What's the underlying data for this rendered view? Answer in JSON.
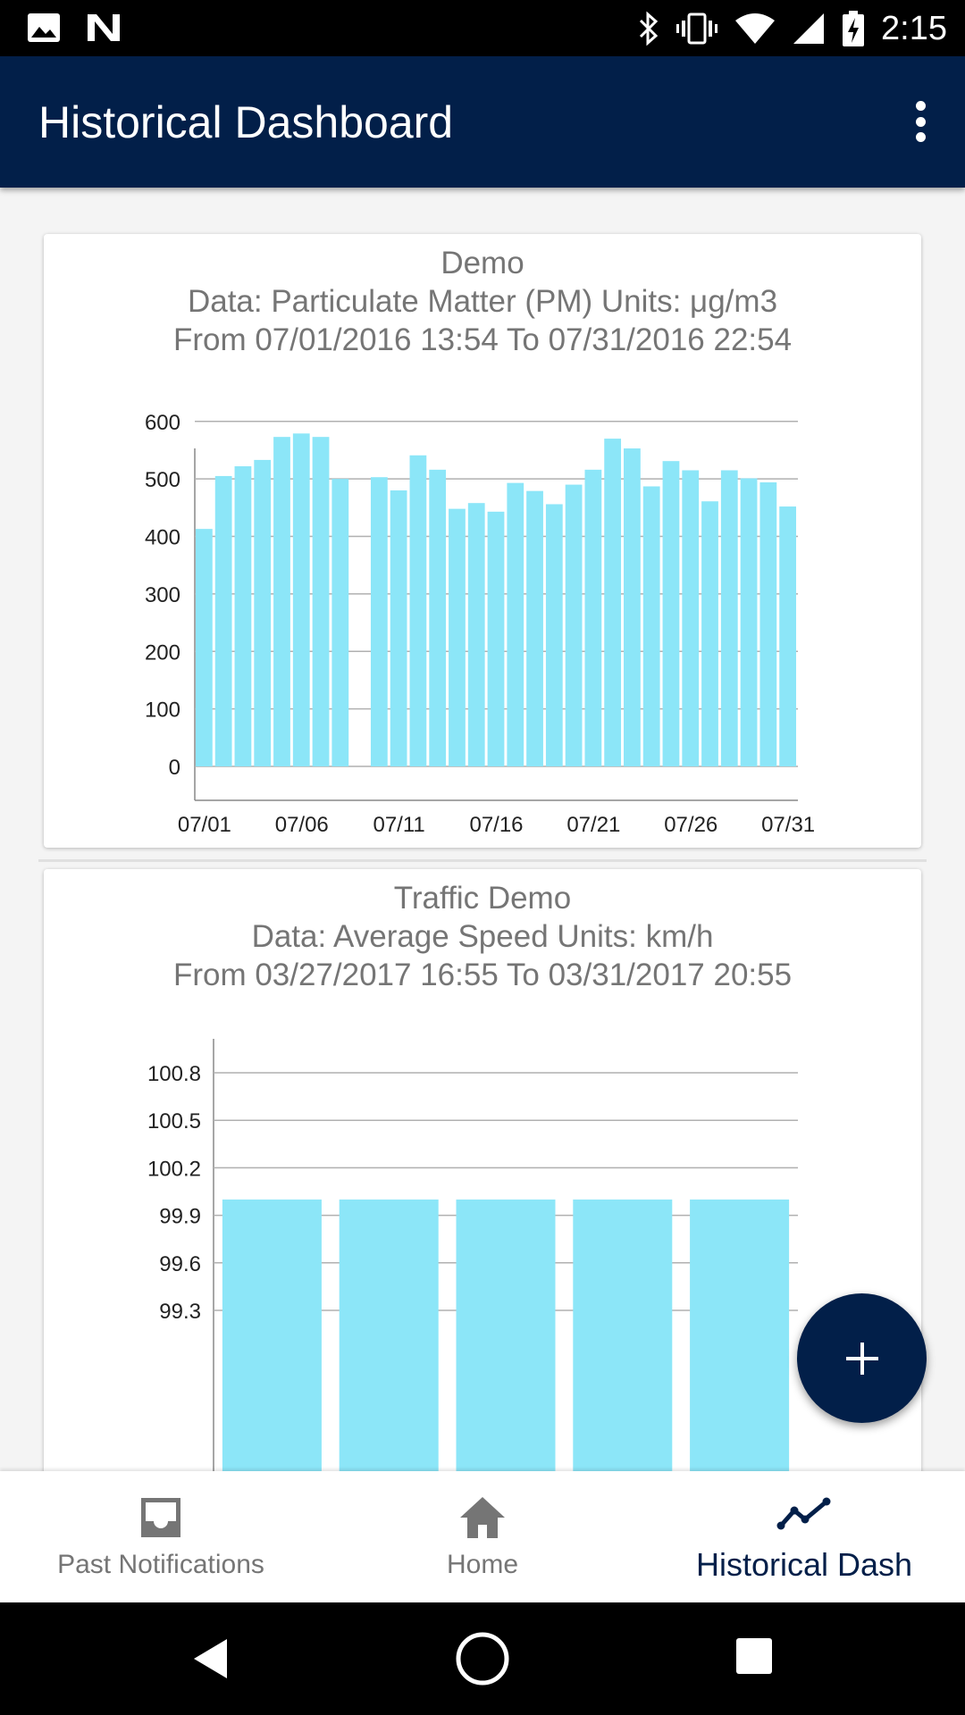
{
  "status_bar": {
    "time": "2:15",
    "left_icons": [
      "image-icon",
      "n-logo-icon"
    ],
    "right_icons": [
      "bluetooth-icon",
      "vibrate-icon",
      "wifi-icon",
      "signal-icon",
      "battery-charging-icon"
    ]
  },
  "app_bar": {
    "title": "Historical Dashboard",
    "menu_icon": "more-vert-icon"
  },
  "cards": [
    {
      "title": "Demo",
      "data_line": "Data: Particulate Matter (PM) Units: μg/m3",
      "range_line": "From 07/01/2016 13:54 To 07/31/2016 22:54"
    },
    {
      "title": "Traffic Demo",
      "data_line": "Data: Average Speed Units: km/h",
      "range_line": "From 03/27/2017 16:55 To 03/31/2017 20:55"
    }
  ],
  "chart_data": [
    {
      "type": "bar",
      "color": "#8ce6f8",
      "y_ticks": [
        0,
        100,
        200,
        300,
        400,
        500,
        600
      ],
      "ylim": [
        0,
        640
      ],
      "x_tick_labels": [
        "07/01",
        "07/06",
        "07/11",
        "07/16",
        "07/21",
        "07/26",
        "07/31"
      ],
      "categories": [
        "07/01",
        "07/02",
        "07/03",
        "07/04",
        "07/05",
        "07/06",
        "07/07",
        "07/08",
        "07/09",
        "07/10",
        "07/11",
        "07/12",
        "07/13",
        "07/14",
        "07/15",
        "07/16",
        "07/17",
        "07/18",
        "07/19",
        "07/20",
        "07/21",
        "07/22",
        "07/23",
        "07/24",
        "07/25",
        "07/26",
        "07/27",
        "07/28",
        "07/29",
        "07/30",
        "07/31"
      ],
      "values": [
        413,
        505,
        522,
        533,
        573,
        579,
        573,
        500,
        null,
        503,
        480,
        541,
        516,
        448,
        458,
        443,
        493,
        479,
        456,
        490,
        516,
        570,
        553,
        487,
        531,
        515,
        461,
        515,
        501,
        494,
        452
      ]
    },
    {
      "type": "bar",
      "color": "#8ce6f8",
      "y_ticks": [
        "99.3",
        "99.6",
        "99.9",
        "100.2",
        "100.5",
        "100.8"
      ],
      "ylim": [
        99.0,
        101.0
      ],
      "values": [
        100.0,
        100.0,
        100.0,
        100.0,
        100.0
      ]
    }
  ],
  "fab": {
    "icon": "plus-icon"
  },
  "bottom_nav": {
    "items": [
      {
        "label": "Past Notifications",
        "icon": "inbox-icon"
      },
      {
        "label": "Home",
        "icon": "home-icon"
      },
      {
        "label": "Historical Dash",
        "icon": "trending-line-icon"
      }
    ],
    "active_index": 2,
    "active_color": "#021f49"
  },
  "system_nav": [
    "back-icon",
    "home-circle-icon",
    "recents-icon"
  ]
}
